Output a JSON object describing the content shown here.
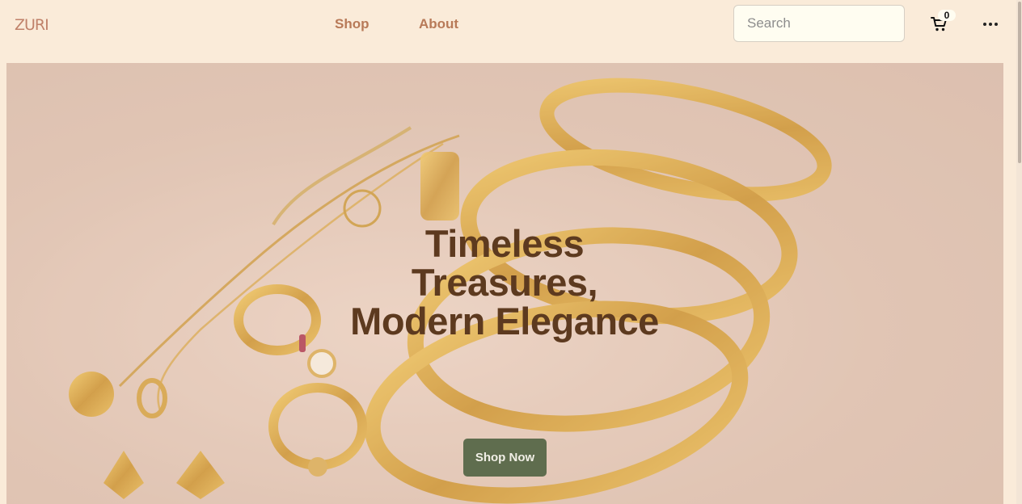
{
  "header": {
    "logo": "ZURI",
    "nav": [
      {
        "label": "Shop"
      },
      {
        "label": "About"
      }
    ],
    "search": {
      "placeholder": "Search",
      "value": ""
    },
    "cart": {
      "count": "0",
      "icon": "cart-icon"
    },
    "more_icon": "more-horizontal-icon"
  },
  "hero": {
    "title_lines": [
      "Timeless",
      "Treasures,",
      "Modern Elegance"
    ],
    "cta_label": "Shop Now",
    "image_description_icon": "jewelry-image"
  },
  "colors": {
    "page_bg": "#faebd9",
    "nav_link": "#b87a58",
    "logo": "#c0826a",
    "hero_title": "#5d3a1f",
    "cta_bg": "#5f6d4e",
    "gold": "#d4a23a"
  }
}
